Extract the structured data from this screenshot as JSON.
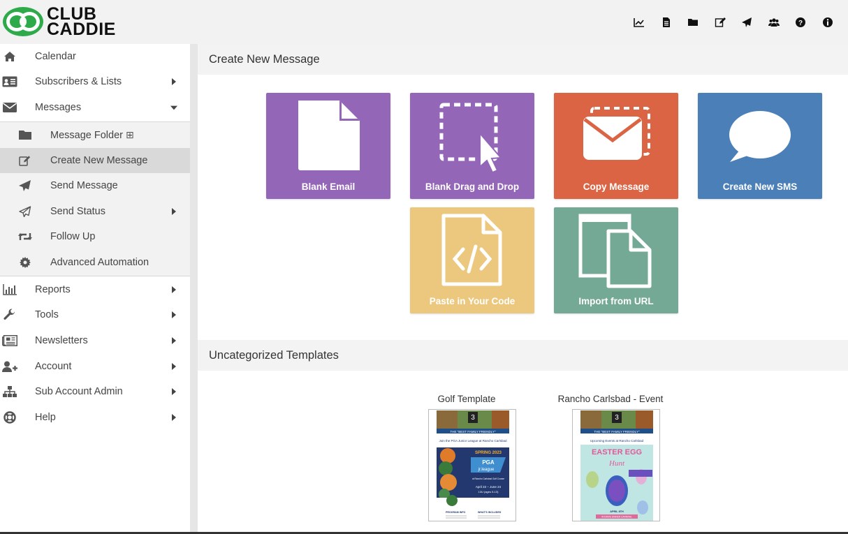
{
  "brand": {
    "line1": "CLUB",
    "line2": "CADDIE",
    "green": "#2eaa4a"
  },
  "top_icons": [
    "chart-line-icon",
    "file-text-icon",
    "folder-icon",
    "edit-icon",
    "paper-plane-icon",
    "users-icon",
    "question-circle-icon",
    "info-circle-icon"
  ],
  "sidebar": {
    "items": [
      {
        "label": "Calendar",
        "icon": "home-icon"
      },
      {
        "label": "Subscribers & Lists",
        "icon": "address-card-icon"
      },
      {
        "label": "Messages",
        "icon": "envelope-icon"
      },
      {
        "label": "Reports",
        "icon": "bar-chart-icon"
      },
      {
        "label": "Tools",
        "icon": "wrench-icon"
      },
      {
        "label": "Newsletters",
        "icon": "newspaper-icon"
      },
      {
        "label": "Account",
        "icon": "user-plus-icon"
      },
      {
        "label": "Sub Account Admin",
        "icon": "sitemap-icon"
      },
      {
        "label": "Help",
        "icon": "life-ring-icon"
      }
    ],
    "messages_sub": [
      {
        "label": "Message Folder",
        "icon": "folder-icon",
        "extra": "⊞"
      },
      {
        "label": "Create New Message",
        "icon": "edit-icon"
      },
      {
        "label": "Send Message",
        "icon": "paper-plane-icon"
      },
      {
        "label": "Send Status",
        "icon": "paper-plane-outline-icon"
      },
      {
        "label": "Follow Up",
        "icon": "retweet-icon"
      },
      {
        "label": "Advanced Automation",
        "icon": "gear-icon"
      }
    ]
  },
  "main": {
    "create_title": "Create New Message",
    "tiles": [
      {
        "label": "Blank Email",
        "color": "#9466b8"
      },
      {
        "label": "Blank Drag and Drop",
        "color": "#9466b8"
      },
      {
        "label": "Copy Message",
        "color": "#db6444"
      },
      {
        "label": "Create New SMS",
        "color": "#4a7fb8"
      },
      {
        "label": "Paste in Your Code",
        "color": "#ecc87e"
      },
      {
        "label": "Import from URL",
        "color": "#74a995"
      }
    ],
    "templates_title": "Uncategorized Templates",
    "templates": [
      {
        "name": "Golf Template"
      },
      {
        "name": "Rancho Carlsbad - Event"
      }
    ]
  },
  "thumb1": {
    "club_mark": "3",
    "tagline": "THE \"BEST FAMILY FRIENDLY\"",
    "headline": "Join the PGA Junior League at Rancho Carlsbad",
    "season": "SPRING 2023",
    "league_top": "PGA",
    "league_bottom": "jr.league",
    "venue": "at Rancho Carlsbad Golf Course",
    "dates": "April 22 – June 24",
    "ages": "13U (ages 5-13)",
    "col1": "PROGRAM INFO",
    "col2": "WHAT'S INCLUDED"
  },
  "thumb2": {
    "club_mark": "3",
    "tagline": "THE \"BEST FAMILY FRIENDLY\"",
    "headline": "Upcoming Events at Rancho Carlsbad",
    "line1": "EASTER EGG",
    "line2": "Hunt",
    "footer1": "APRIL 8TH",
    "footer2": "IN DRIVE DINNER CARNIVAL"
  }
}
